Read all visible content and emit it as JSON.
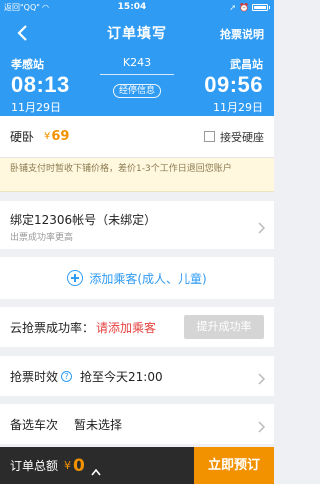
{
  "status_bar": {
    "back_app": "返回\"QQ\"",
    "time": "15:04"
  },
  "header": {
    "title": "订单填写",
    "help": "抢票说明"
  },
  "train": {
    "number": "K243",
    "stops_label": "经停信息",
    "departure": {
      "station": "孝感站",
      "time": "08:13",
      "date": "11月29日"
    },
    "arrival": {
      "station": "武昌站",
      "time": "09:56",
      "date": "11月29日"
    }
  },
  "seat": {
    "name": "硬卧",
    "currency": "¥",
    "price": "69",
    "accept_label": "接受硬座"
  },
  "notice": "卧铺支付时暂收下铺价格，差价1-3个工作日退回您账户",
  "bind_account": {
    "title": "绑定12306帐号（未绑定）",
    "subtitle": "出票成功率更高"
  },
  "add_passenger": "添加乘客(成人、儿童)",
  "success_rate": {
    "label": "云抢票成功率：",
    "value": "请添加乘客",
    "boost_button": "提升成功率"
  },
  "validity": {
    "label": "抢票时效",
    "value": "抢至今天21:00"
  },
  "backup_train": {
    "label": "备选车次",
    "value": "暂未选择"
  },
  "bottom": {
    "total_label": "订单总额",
    "currency": "¥",
    "total": "0",
    "submit": "立即预订"
  }
}
